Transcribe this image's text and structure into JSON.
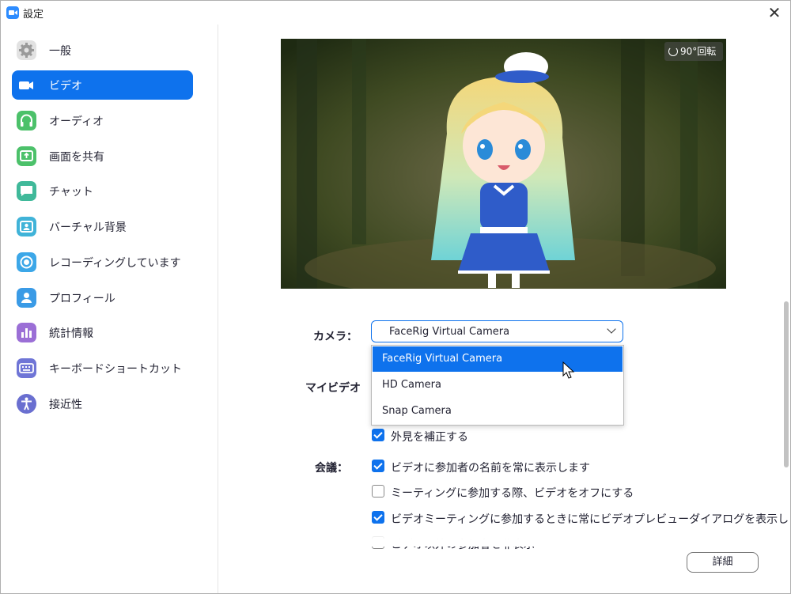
{
  "window": {
    "title": "設定",
    "close_label": "✕"
  },
  "colors": {
    "accent": "#0e72ed",
    "zoom_blue": "#2d8cff"
  },
  "sidebar": {
    "items": [
      {
        "label": "一般",
        "icon": "gear-icon",
        "color": "#e0e0e0",
        "active": false
      },
      {
        "label": "ビデオ",
        "icon": "video-camera-icon",
        "color": "#ffffff",
        "active": true
      },
      {
        "label": "オーディオ",
        "icon": "headphones-icon",
        "color": "#4cc16a",
        "active": false
      },
      {
        "label": "画面を共有",
        "icon": "share-screen-icon",
        "color": "#4cc16a",
        "active": false
      },
      {
        "label": "チャット",
        "icon": "chat-bubble-icon",
        "color": "#40b99a",
        "active": false
      },
      {
        "label": "バーチャル背景",
        "icon": "virtual-background-icon",
        "color": "#40b3d8",
        "active": false
      },
      {
        "label": "レコーディングしています",
        "icon": "record-icon",
        "color": "#3ca7e8",
        "active": false
      },
      {
        "label": "プロフィール",
        "icon": "profile-icon",
        "color": "#3a9be6",
        "active": false
      },
      {
        "label": "統計情報",
        "icon": "statistics-icon",
        "color": "#9b6fd6",
        "active": false
      },
      {
        "label": "キーボードショートカット",
        "icon": "keyboard-icon",
        "color": "#6f75d6",
        "active": false
      },
      {
        "label": "接近性",
        "icon": "accessibility-icon",
        "color": "#6a6fd0",
        "active": false
      }
    ]
  },
  "preview": {
    "rotate_label": "90°回転"
  },
  "camera": {
    "label": "カメラ：",
    "selected": "FaceRig Virtual Camera",
    "options": [
      "FaceRig Virtual Camera",
      "HD Camera",
      "Snap Camera"
    ]
  },
  "my_video": {
    "label": "マイビデオ"
  },
  "checkbox_appearance": {
    "label": "外見を補正する",
    "checked": true
  },
  "meeting": {
    "label": "会議：",
    "options": [
      {
        "label": "ビデオに参加者の名前を常に表示します",
        "checked": true
      },
      {
        "label": "ミーティングに参加する際、ビデオをオフにする",
        "checked": false
      },
      {
        "label": "ビデオミーティングに参加するときに常にビデオプレビューダイアログを表示します",
        "checked": true
      },
      {
        "label": "ビデオ以外の参加者を非表示",
        "checked": false
      }
    ]
  },
  "detail_button": {
    "label": "詳細"
  }
}
